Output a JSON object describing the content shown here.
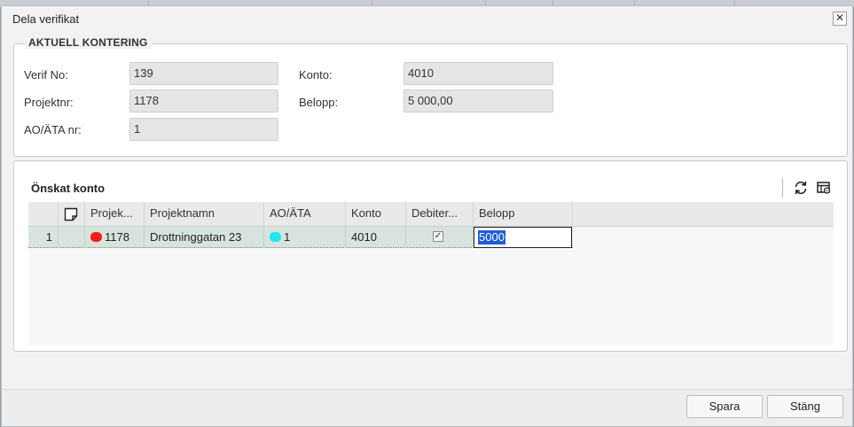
{
  "dialog": {
    "title": "Dela verifikat"
  },
  "current": {
    "legend": "AKTUELL KONTERING",
    "verif_label": "Verif No:",
    "verif_value": "139",
    "projekt_label": "Projektnr:",
    "projekt_value": "1178",
    "ao_label": "AO/ÄTA nr:",
    "ao_value": "1",
    "konto_label": "Konto:",
    "konto_value": "4010",
    "belopp_label": "Belopp:",
    "belopp_value": "5 000,00"
  },
  "grid": {
    "title": "Önskat konto",
    "columns": [
      "Projek...",
      "Projektnamn",
      "AO/ÄTA",
      "Konto",
      "Debiter...",
      "Belopp"
    ],
    "rows": [
      {
        "num": "1",
        "projekt": "1178",
        "projekt_color": "#ff1a1a",
        "projektnamn": "Drottninggatan 23",
        "ao": "1",
        "ao_color": "#22e6ee",
        "konto": "4010",
        "debiteras": true,
        "belopp": "5000"
      }
    ]
  },
  "icons": {
    "refresh": "refresh-icon",
    "layout": "grid-settings-icon",
    "note": "note-icon",
    "close": "close-icon"
  },
  "footer": {
    "save_label": "Spara",
    "close_label": "Stäng"
  }
}
